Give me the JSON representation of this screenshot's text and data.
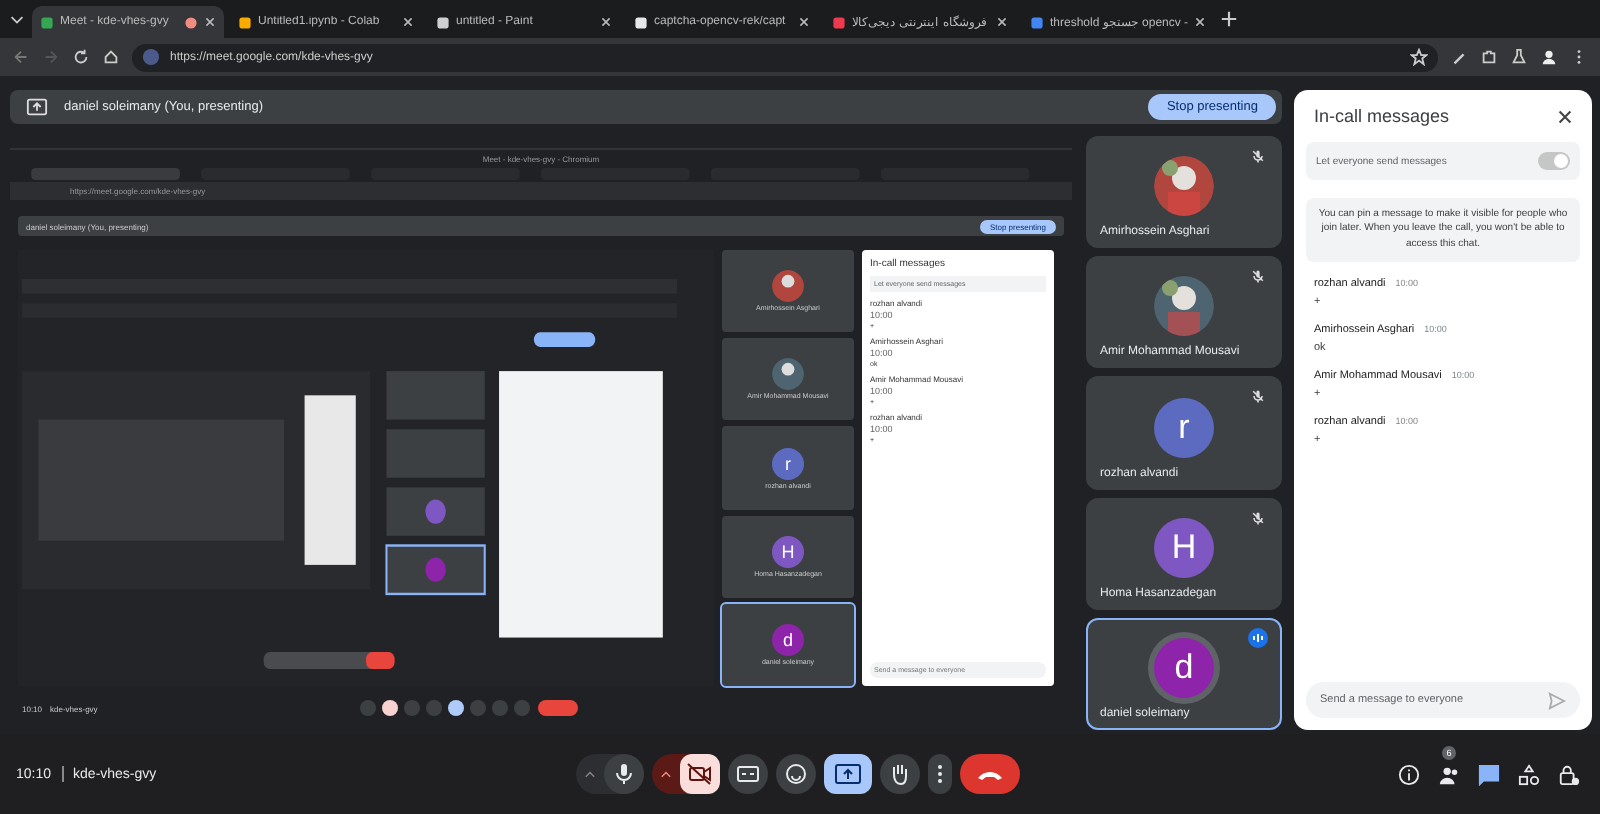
{
  "browser": {
    "tabs": [
      {
        "title": "Meet - kde-vhes-gvy",
        "selected": true,
        "recording": true
      },
      {
        "title": "Untitled1.ipynb - Colab",
        "selected": false,
        "recording": false
      },
      {
        "title": "untitled - Paint",
        "selected": false,
        "recording": false
      },
      {
        "title": "captcha-opencv-rek/capt",
        "selected": false,
        "recording": false
      },
      {
        "title": "فروشگاه اینترنتی دیجی‌کالا",
        "selected": false,
        "recording": false
      },
      {
        "title": "threshold جستجو opencv -",
        "selected": false,
        "recording": false
      }
    ],
    "url": "https://meet.google.com/kde-vhes-gvy"
  },
  "presenting_bar": {
    "label": "daniel soleimany (You, presenting)",
    "button": "Stop presenting"
  },
  "shared_screen": {
    "window_title": "Meet - kde-vhes-gvy - Chromium",
    "url": "https://meet.google.com/kde-vhes-gvy",
    "presenting_label": "daniel soleimany (You, presenting)",
    "button": "Stop presenting",
    "participants": [
      {
        "name": "Amirhossein Asghari",
        "kind": "picture"
      },
      {
        "name": "Amir Mohammad Mousavi",
        "kind": "picture"
      },
      {
        "name": "rozhan alvandi",
        "kind": "letter",
        "letter": "r",
        "color": "#5c6bc0"
      },
      {
        "name": "Homa Hasanzadegan",
        "kind": "letter",
        "letter": "H",
        "color": "#7e57c2"
      },
      {
        "name": "daniel soleimany",
        "kind": "letter",
        "letter": "d",
        "color": "#8e24aa"
      }
    ],
    "chat_title": "In-call messages",
    "toggle_label": "Let everyone send messages",
    "messages": [
      {
        "sender": "rozhan alvandi",
        "time": "10:00",
        "text": "+"
      },
      {
        "sender": "Amirhossein Asghari",
        "time": "10:00",
        "text": "ok"
      },
      {
        "sender": "Amir Mohammad Mousavi",
        "time": "10:00",
        "text": "+"
      },
      {
        "sender": "rozhan alvandi",
        "time": "10:00",
        "text": "+"
      }
    ],
    "placeholder": "Send a message to everyone",
    "time": "10:10",
    "code": "kde-vhes-gvy"
  },
  "participants": [
    {
      "name": "Amirhossein Asghari",
      "kind": "picture",
      "muted": true,
      "speaking": false,
      "highlighted": false
    },
    {
      "name": "Amir Mohammad Mousavi",
      "kind": "picture",
      "muted": true,
      "speaking": false,
      "highlighted": false
    },
    {
      "name": "rozhan alvandi",
      "kind": "letter",
      "letter": "r",
      "color": "#5c6bc0",
      "muted": true,
      "speaking": false,
      "highlighted": false
    },
    {
      "name": "Homa Hasanzadegan",
      "kind": "letter",
      "letter": "H",
      "color": "#7e57c2",
      "muted": true,
      "speaking": false,
      "highlighted": false
    },
    {
      "name": "daniel soleimany",
      "kind": "letter",
      "letter": "d",
      "color": "#8e24aa",
      "muted": false,
      "speaking": true,
      "highlighted": true
    }
  ],
  "chat": {
    "title": "In-call messages",
    "toggle_label": "Let everyone send messages",
    "toggle_on": true,
    "notice": "You can pin a message to make it visible for people who join later. When you leave the call, you won't be able to access this chat.",
    "messages": [
      {
        "sender": "rozhan alvandi",
        "time": "10:00",
        "text": "+"
      },
      {
        "sender": "Amirhossein Asghari",
        "time": "10:00",
        "text": "ok"
      },
      {
        "sender": "Amir Mohammad Mousavi",
        "time": "10:00",
        "text": "+"
      },
      {
        "sender": "rozhan alvandi",
        "time": "10:00",
        "text": "+"
      }
    ],
    "placeholder": "Send a message to everyone"
  },
  "bottom_bar": {
    "time": "10:10",
    "code": "kde-vhes-gvy",
    "participant_count": "6",
    "mic_on": true,
    "camera_on": false,
    "presenting": true,
    "chat_open": true
  }
}
